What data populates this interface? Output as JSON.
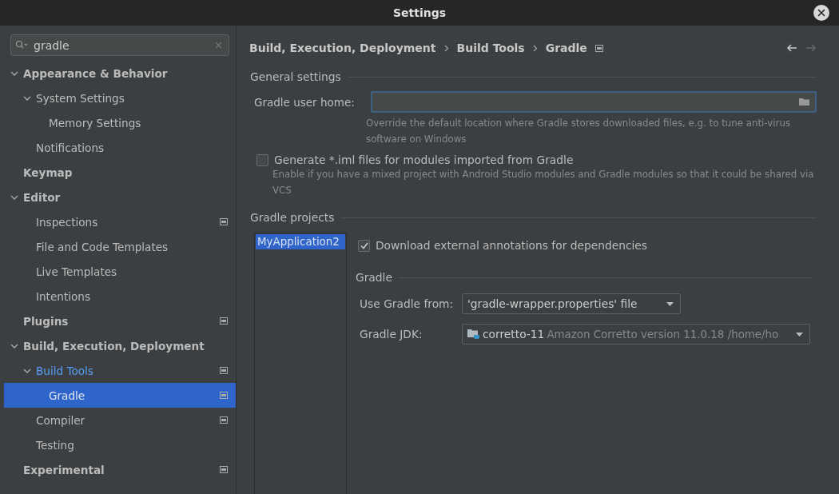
{
  "window": {
    "title": "Settings"
  },
  "search": {
    "value": "gradle"
  },
  "tree": [
    {
      "label": "Appearance & Behavior",
      "expanded": true,
      "selected": false,
      "project_level": false,
      "children": [
        {
          "label": "System Settings",
          "expanded": true,
          "selected": false,
          "project_level": false,
          "children": [
            {
              "label": "Memory Settings",
              "selected": false,
              "project_level": false
            }
          ]
        },
        {
          "label": "Notifications",
          "selected": false,
          "project_level": false
        }
      ]
    },
    {
      "label": "Keymap",
      "selected": false,
      "project_level": false
    },
    {
      "label": "Editor",
      "expanded": true,
      "selected": false,
      "project_level": false,
      "children": [
        {
          "label": "Inspections",
          "selected": false,
          "project_level": true
        },
        {
          "label": "File and Code Templates",
          "selected": false,
          "project_level": false
        },
        {
          "label": "Live Templates",
          "selected": false,
          "project_level": false
        },
        {
          "label": "Intentions",
          "selected": false,
          "project_level": false
        }
      ]
    },
    {
      "label": "Plugins",
      "selected": false,
      "project_level": true
    },
    {
      "label": "Build, Execution, Deployment",
      "expanded": true,
      "selected": false,
      "project_level": false,
      "children": [
        {
          "label": "Build Tools",
          "expanded": true,
          "selected": false,
          "project_level": true,
          "children": [
            {
              "label": "Gradle",
              "selected": true,
              "project_level": true
            }
          ]
        },
        {
          "label": "Compiler",
          "selected": false,
          "project_level": true
        },
        {
          "label": "Testing",
          "selected": false,
          "project_level": false
        }
      ]
    },
    {
      "label": "Experimental",
      "selected": false,
      "project_level": true
    }
  ],
  "breadcrumb": [
    "Build, Execution, Deployment",
    "Build Tools",
    "Gradle"
  ],
  "general": {
    "title": "General settings",
    "user_home_label": "Gradle user home:",
    "user_home_hint": "Override the default location where Gradle stores downloaded files, e.g. to tune anti-virus software on Windows",
    "iml_label": "Generate *.iml files for modules imported from Gradle",
    "iml_checked": false,
    "iml_hint": "Enable if you have a mixed project with Android Studio modules and Gradle modules so that it could be shared via VCS"
  },
  "projects": {
    "title": "Gradle projects",
    "items": [
      {
        "label": "MyApplication2",
        "selected": true
      }
    ],
    "annotations_label": "Download external annotations for dependencies",
    "annotations_checked": true,
    "gradle_title": "Gradle",
    "use_from_label": "Use Gradle from:",
    "use_from_value": "'gradle-wrapper.properties' file",
    "jdk_label": "Gradle JDK:",
    "jdk_name": "corretto-11",
    "jdk_detail": "Amazon Corretto version 11.0.18 /home/ho"
  }
}
